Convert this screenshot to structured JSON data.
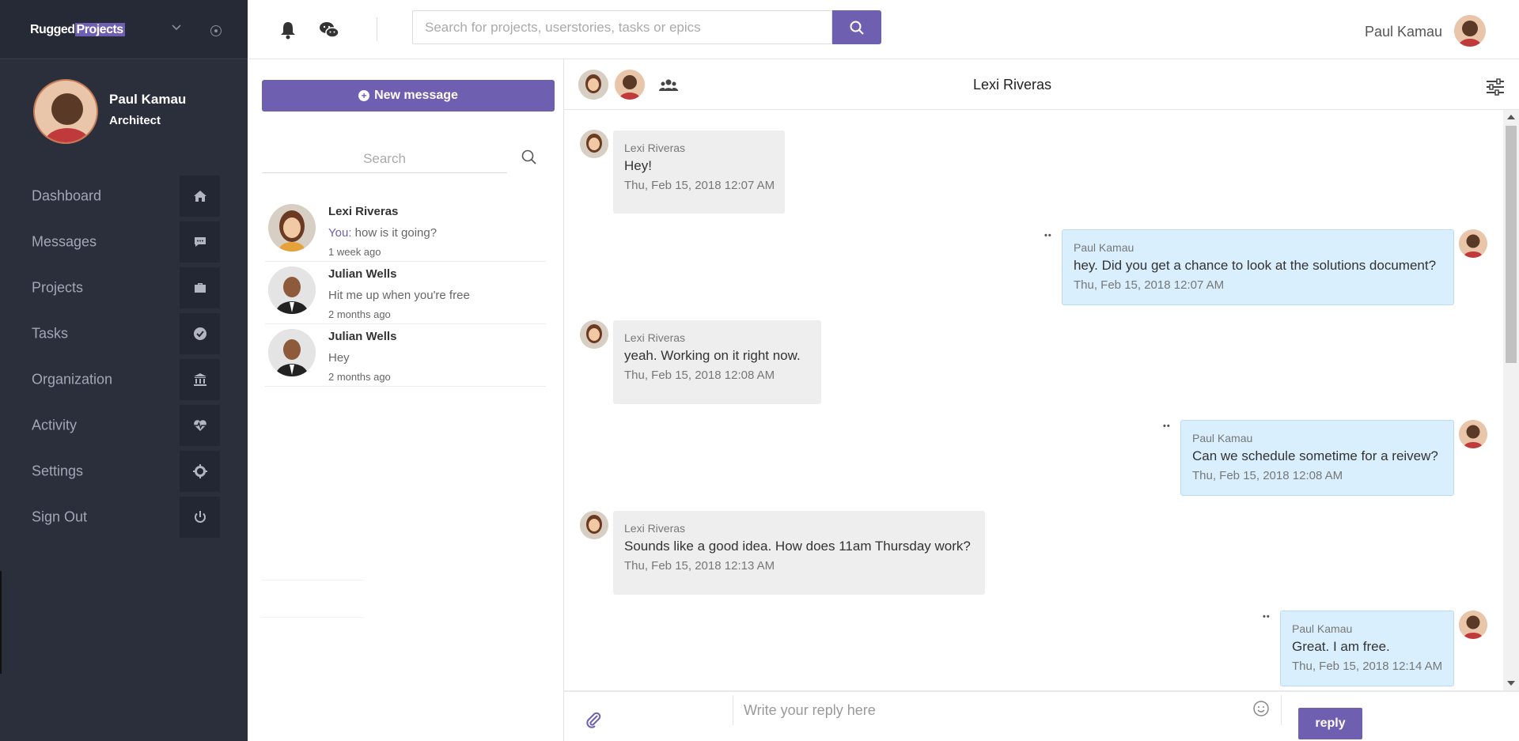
{
  "brand": {
    "name_part1": "Rugged",
    "name_part2": "Projects"
  },
  "user": {
    "name": "Paul Kamau",
    "role": "Architect"
  },
  "nav": [
    {
      "label": "Dashboard",
      "icon": "home-icon"
    },
    {
      "label": "Messages",
      "icon": "chat-icon"
    },
    {
      "label": "Projects",
      "icon": "briefcase-icon"
    },
    {
      "label": "Tasks",
      "icon": "check-circle-icon"
    },
    {
      "label": "Organization",
      "icon": "bank-icon"
    },
    {
      "label": "Activity",
      "icon": "heartbeat-icon"
    },
    {
      "label": "Settings",
      "icon": "gear-icon"
    },
    {
      "label": "Sign Out",
      "icon": "power-icon"
    }
  ],
  "topbar": {
    "search_placeholder": "Search for projects, userstories, tasks or epics",
    "user_name": "Paul Kamau"
  },
  "conversations": {
    "new_message_label": "New message",
    "search_placeholder": "Search",
    "items": [
      {
        "name": "Lexi Riveras",
        "you_prefix": "You:",
        "preview": " how is it going?",
        "time": "1 week ago"
      },
      {
        "name": "Julian Wells",
        "you_prefix": "",
        "preview": "Hit me up when you're free",
        "time": "2 months ago"
      },
      {
        "name": "Julian Wells",
        "you_prefix": "",
        "preview": "Hey",
        "time": "2 months ago"
      }
    ]
  },
  "chat": {
    "title": "Lexi Riveras",
    "messages": [
      {
        "from": "Lexi Riveras",
        "text": "Hey!",
        "time": "Thu, Feb 15, 2018 12:07 AM",
        "outgoing": false
      },
      {
        "from": "Paul Kamau",
        "text": "hey. Did you get a chance to look at the solutions document?",
        "time": "Thu, Feb 15, 2018 12:07 AM",
        "outgoing": true
      },
      {
        "from": "Lexi Riveras",
        "text": "yeah. Working on it right now.",
        "time": "Thu, Feb 15, 2018 12:08 AM",
        "outgoing": false
      },
      {
        "from": "Paul Kamau",
        "text": "Can we schedule sometime for a reivew?",
        "time": "Thu, Feb 15, 2018 12:08 AM",
        "outgoing": true
      },
      {
        "from": "Lexi Riveras",
        "text": "Sounds like a good idea. How does 11am Thursday work?",
        "time": "Thu, Feb 15, 2018 12:13 AM",
        "outgoing": false
      },
      {
        "from": "Paul Kamau",
        "text": "Great. I am free.",
        "time": "Thu, Feb 15, 2018 12:14 AM",
        "outgoing": true
      }
    ],
    "reply_placeholder": "Write your reply here",
    "reply_label": "reply"
  },
  "colors": {
    "accent": "#6f5fb0",
    "sidebar_bg": "#2b2e3b",
    "incoming_bubble": "#eeeeee",
    "outgoing_bubble": "#d9effd"
  }
}
